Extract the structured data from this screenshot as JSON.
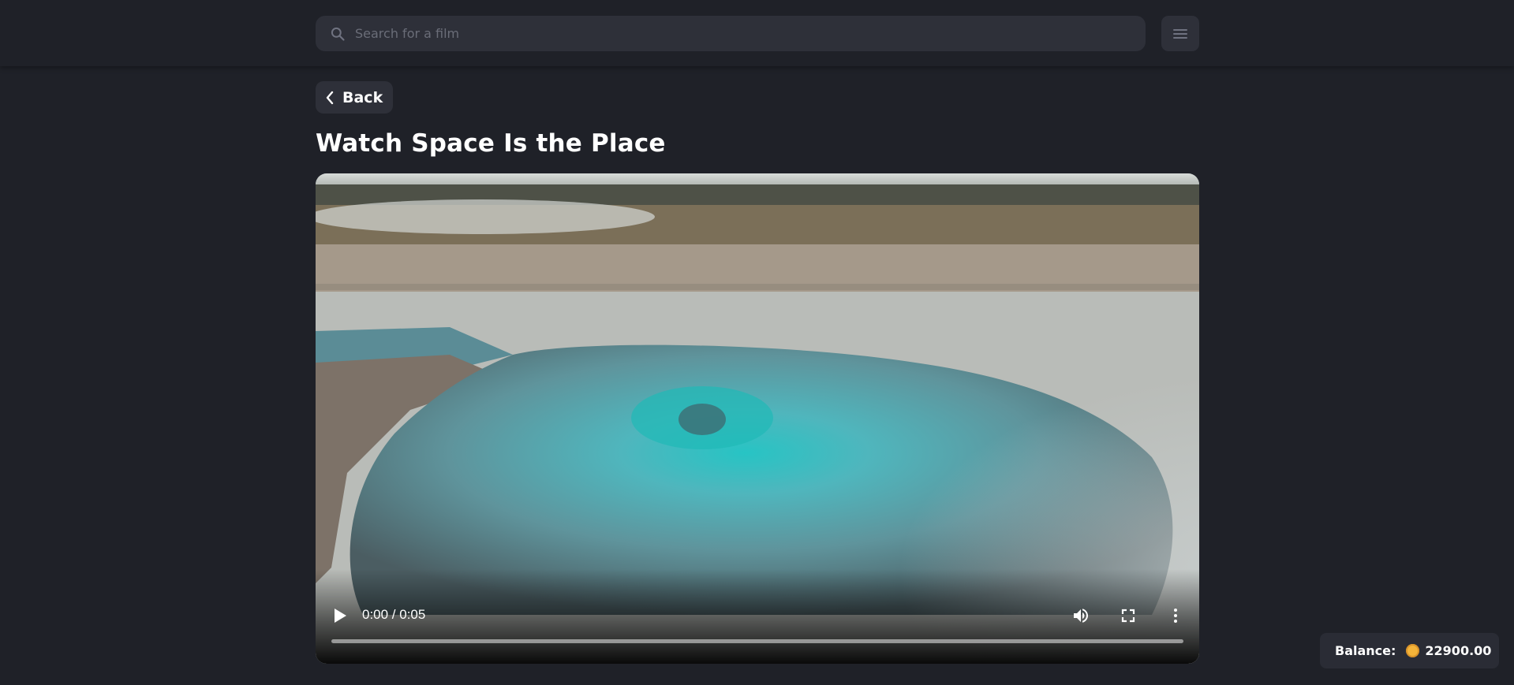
{
  "header": {
    "search": {
      "placeholder": "Search for a film",
      "value": ""
    },
    "search_icon": "search-icon",
    "menu_icon": "hamburger-menu-icon"
  },
  "navigation": {
    "back_label": "Back",
    "back_icon": "chevron-left-icon"
  },
  "page": {
    "title": "Watch Space Is the Place"
  },
  "video": {
    "time_display": "0:00 / 0:05",
    "progress": 0,
    "state": "paused",
    "controls": [
      "play-icon",
      "volume-icon",
      "fullscreen-icon",
      "more-options-icon"
    ]
  },
  "balance": {
    "label": "Balance:",
    "amount": "22900.00",
    "coin_color": "#f4b43a"
  },
  "colors": {
    "background": "#1f2128",
    "surface": "#2e3039",
    "text": "#ffffff"
  }
}
